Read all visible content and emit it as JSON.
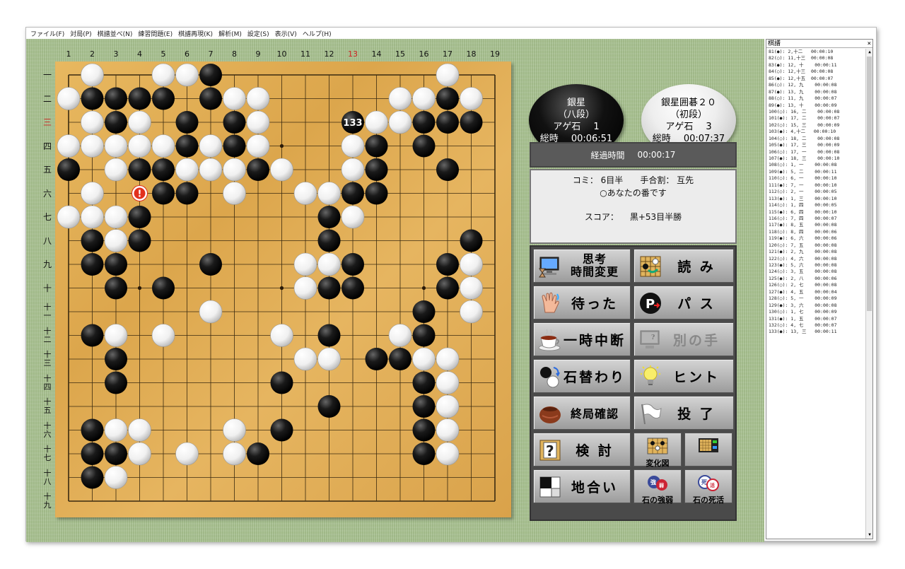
{
  "menu": [
    "ファイル(F)",
    "対局(P)",
    "棋譜並べ(N)",
    "練習問題(E)",
    "棋譜再現(K)",
    "解析(M)",
    "設定(S)",
    "表示(V)",
    "ヘルプ(H)"
  ],
  "board": {
    "size": 19,
    "col_labels": [
      "1",
      "2",
      "3",
      "4",
      "5",
      "6",
      "7",
      "8",
      "9",
      "10",
      "11",
      "12",
      "13",
      "14",
      "15",
      "16",
      "17",
      "18",
      "19"
    ],
    "row_labels": [
      "一",
      "二",
      "三",
      "四",
      "五",
      "六",
      "七",
      "八",
      "九",
      "十",
      "十一",
      "十二",
      "十三",
      "十四",
      "十五",
      "十六",
      "十七",
      "十八",
      "十九"
    ],
    "highlight_col": 13,
    "highlight_row": 3,
    "highlight_color": "#cc2222",
    "last_move": {
      "col": 13,
      "row": 3,
      "number": "133",
      "color": "black"
    },
    "warning_mark": {
      "col": 4,
      "row": 6,
      "symbol": "!"
    },
    "black_stones": [
      [
        7,
        1
      ],
      [
        2,
        2
      ],
      [
        3,
        2
      ],
      [
        4,
        2
      ],
      [
        5,
        2
      ],
      [
        7,
        2
      ],
      [
        17,
        2
      ],
      [
        3,
        3
      ],
      [
        6,
        3
      ],
      [
        8,
        3
      ],
      [
        16,
        3
      ],
      [
        17,
        3
      ],
      [
        18,
        3
      ],
      [
        6,
        4
      ],
      [
        8,
        4
      ],
      [
        14,
        4
      ],
      [
        16,
        4
      ],
      [
        1,
        5
      ],
      [
        4,
        5
      ],
      [
        5,
        5
      ],
      [
        9,
        5
      ],
      [
        14,
        5
      ],
      [
        17,
        5
      ],
      [
        5,
        6
      ],
      [
        6,
        6
      ],
      [
        13,
        6
      ],
      [
        14,
        6
      ],
      [
        4,
        7
      ],
      [
        12,
        7
      ],
      [
        2,
        8
      ],
      [
        4,
        8
      ],
      [
        12,
        8
      ],
      [
        18,
        8
      ],
      [
        2,
        9
      ],
      [
        3,
        9
      ],
      [
        7,
        9
      ],
      [
        13,
        9
      ],
      [
        17,
        9
      ],
      [
        3,
        10
      ],
      [
        5,
        10
      ],
      [
        12,
        10
      ],
      [
        13,
        10
      ],
      [
        17,
        10
      ],
      [
        16,
        11
      ],
      [
        2,
        12
      ],
      [
        12,
        12
      ],
      [
        16,
        12
      ],
      [
        3,
        13
      ],
      [
        14,
        13
      ],
      [
        15,
        13
      ],
      [
        3,
        14
      ],
      [
        10,
        14
      ],
      [
        16,
        14
      ],
      [
        12,
        15
      ],
      [
        16,
        15
      ],
      [
        2,
        16
      ],
      [
        10,
        16
      ],
      [
        16,
        16
      ],
      [
        2,
        17
      ],
      [
        3,
        17
      ],
      [
        9,
        17
      ],
      [
        16,
        17
      ],
      [
        2,
        18
      ]
    ],
    "white_stones": [
      [
        2,
        1
      ],
      [
        5,
        1
      ],
      [
        6,
        1
      ],
      [
        17,
        1
      ],
      [
        1,
        2
      ],
      [
        8,
        2
      ],
      [
        9,
        2
      ],
      [
        15,
        2
      ],
      [
        16,
        2
      ],
      [
        18,
        2
      ],
      [
        2,
        3
      ],
      [
        4,
        3
      ],
      [
        9,
        3
      ],
      [
        14,
        3
      ],
      [
        15,
        3
      ],
      [
        1,
        4
      ],
      [
        2,
        4
      ],
      [
        3,
        4
      ],
      [
        4,
        4
      ],
      [
        5,
        4
      ],
      [
        7,
        4
      ],
      [
        9,
        4
      ],
      [
        13,
        4
      ],
      [
        3,
        5
      ],
      [
        6,
        5
      ],
      [
        7,
        5
      ],
      [
        8,
        5
      ],
      [
        10,
        5
      ],
      [
        13,
        5
      ],
      [
        2,
        6
      ],
      [
        8,
        6
      ],
      [
        11,
        6
      ],
      [
        12,
        6
      ],
      [
        1,
        7
      ],
      [
        2,
        7
      ],
      [
        3,
        7
      ],
      [
        13,
        7
      ],
      [
        3,
        8
      ],
      [
        11,
        9
      ],
      [
        12,
        9
      ],
      [
        18,
        9
      ],
      [
        11,
        10
      ],
      [
        18,
        10
      ],
      [
        7,
        11
      ],
      [
        18,
        11
      ],
      [
        3,
        12
      ],
      [
        5,
        12
      ],
      [
        10,
        12
      ],
      [
        15,
        12
      ],
      [
        11,
        13
      ],
      [
        12,
        13
      ],
      [
        16,
        13
      ],
      [
        17,
        13
      ],
      [
        17,
        14
      ],
      [
        17,
        15
      ],
      [
        3,
        16
      ],
      [
        4,
        16
      ],
      [
        8,
        16
      ],
      [
        17,
        16
      ],
      [
        4,
        17
      ],
      [
        6,
        17
      ],
      [
        8,
        17
      ],
      [
        17,
        17
      ],
      [
        3,
        18
      ]
    ]
  },
  "black_player": {
    "name": "銀星",
    "rank": "（八段）",
    "captures_label": "アゲ石",
    "captures": "1",
    "time_label": "総時",
    "time": "00:06:51"
  },
  "white_player": {
    "name": "銀星囲碁２０",
    "rank": "（初段）",
    "captures_label": "アゲ石",
    "captures": "3",
    "time_label": "総時",
    "time": "00:07:37"
  },
  "elapsed": {
    "label": "経過時間",
    "time": "00:00:17"
  },
  "game_info": {
    "komi": "コミ： 6目半",
    "handicap": "手合割： 互先",
    "turn": "○あなたの番です",
    "score_label": "スコア：",
    "score": "黒+53目半勝"
  },
  "buttons": {
    "think_time": "思考\n時間変更",
    "read": "読 み",
    "undo": "待った",
    "pass": "パ ス",
    "pause": "一時中断",
    "other_move": "別の手",
    "swap": "石替わり",
    "hint": "ヒント",
    "end_confirm": "終局確認",
    "resign": "投 了",
    "review": "検 討",
    "variation": "変化図",
    "territory": "地合い",
    "strength": "石の強弱",
    "life_death": "石の死活"
  },
  "colors": {
    "accent_red": "#cc2222",
    "selection": "#1b2e6a",
    "tatami": "#a6bf8e",
    "board": "#dfa94f"
  },
  "kifu": {
    "title": "棋譜",
    "close": "×",
    "scroll_up": "▲",
    "scroll_down": "▼",
    "selected_index": 52,
    "rows": [
      "81(●): 2,十二   00:00:10",
      "82(○): 11,十三  00:00:08",
      "83(●): 12, 十    00:00:11",
      "84(○): 12,十三  00:00:08",
      "85(●): 12,十五  00:00:07",
      "86(○): 12, 九    00:00:08",
      "87(●): 13, 九    00:00:08",
      "88(○): 11, 九    00:00:07",
      "89(●): 13, 十    00:00:09",
      "100(○): 16, 二    00:00:08",
      "101(●): 17, 二    00:00:07",
      "102(○): 15, 三    00:00:09",
      "103(●): 4,十二   00:00:10",
      "104(○): 18, 二    00:00:08",
      "105(●): 17, 三    00:00:09",
      "106(○): 17, 一    00:00:08",
      "107(●): 18, 三    00:00:10",
      "108(○): 1, 一    00:00:08",
      "109(●): 5, 二    00:00:11",
      "110(○): 6, 一    00:00:10",
      "111(●): 7, 一    00:00:10",
      "112(○): 2, 一    00:00:05",
      "113(●): 1, 三    00:00:10",
      "114(○): 1, 四    00:00:05",
      "115(●): 6, 四    00:00:10",
      "116(○): 7, 四    00:00:07",
      "117(●): 8, 五    00:00:08",
      "118(○): 8, 四    00:00:06",
      "119(●): 6, 六    00:00:06",
      "120(○): 7, 五    00:00:08",
      "121(●): 2, 九    00:00:08",
      "122(○): 4, 六    00:00:08",
      "123(●): 5, 六    00:00:08",
      "124(○): 3, 五    00:00:08",
      "125(●): 2, 八    00:00:06",
      "126(○): 2, 七    00:00:08",
      "127(●): 4, 五    00:00:04",
      "128(○): 5, 一    00:00:09",
      "129(●): 3, 六    00:00:08",
      "130(○): 1, 七    00:00:09",
      "131(●): 1, 五    00:00:07",
      "132(○): 4, 七    00:00:07",
      "133(●): 13, 三   00:00:11"
    ]
  }
}
